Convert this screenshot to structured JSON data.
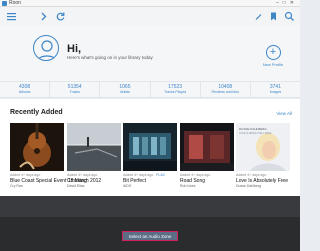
{
  "window": {
    "title": "Roon"
  },
  "header": {
    "greeting": "Hi,",
    "subtitle": "Here's what's going on in your library today",
    "new_profile_label": "New Profile",
    "new_profile_icon": "+"
  },
  "stats": [
    {
      "value": "4308",
      "label": "Albums"
    },
    {
      "value": "51354",
      "label": "Tracks"
    },
    {
      "value": "1065",
      "label": "Artists"
    },
    {
      "value": "17523",
      "label": "Tracks Played"
    },
    {
      "value": "10408",
      "label": "Reviews and bios"
    },
    {
      "value": "3741",
      "label": "Images"
    }
  ],
  "recent": {
    "title": "Recently Added",
    "view_all": "View All",
    "items": [
      {
        "added": "Added 4+ days ago",
        "title": "Blue Coast Special Event 18 March 2012",
        "artist": "Cry Ran"
      },
      {
        "added": "Added 4+ days ago",
        "title": "Crossing",
        "artist": "David Elias"
      },
      {
        "added": "Added 4+ days ago",
        "badge": "FLAC",
        "title": "Bit Perfect",
        "artist": "AIDS"
      },
      {
        "added": "Added 4+ days ago",
        "title": "Road Song",
        "artist": "Rob Ickes"
      },
      {
        "added": "Added 4+ days ago",
        "title": "Love Is Absolutely Free",
        "artist": "Dusse Dahlberg"
      }
    ]
  },
  "covers": {
    "4": {
      "artist": "DUSSE DAHLBERG",
      "title": "LOVE IS ABSOLUTELY FREE"
    }
  },
  "footer": {
    "zone_button": "Select an Audio Zone"
  },
  "colors": {
    "accent": "#3e86c6",
    "footer_bg": "#2b2c2e",
    "highlight": "#d2205a"
  }
}
